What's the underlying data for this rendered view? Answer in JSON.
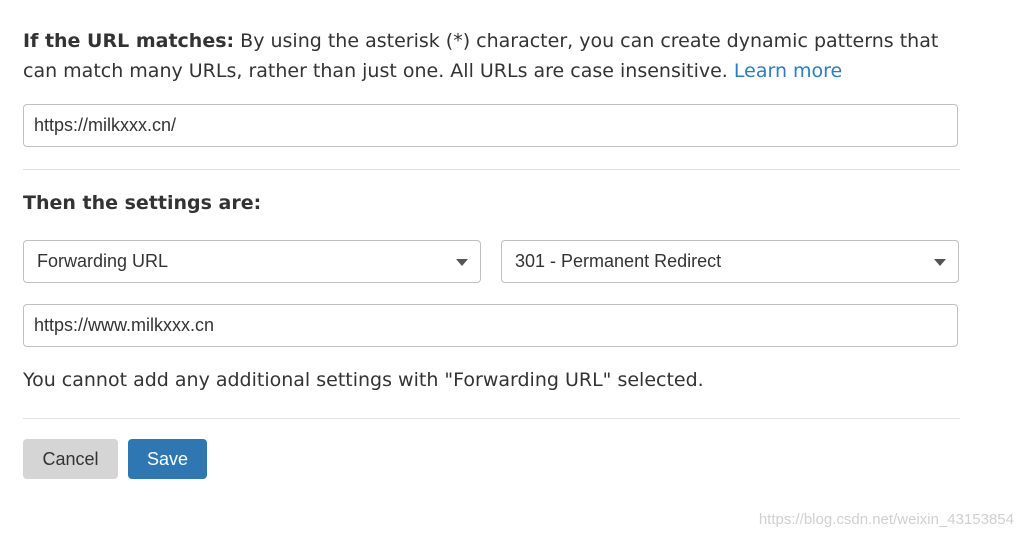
{
  "intro": {
    "label": "If the URL matches:",
    "text": "By using the asterisk (*) character, you can create dynamic patterns that can match many URLs, rather than just one. All URLs are case insensitive.",
    "link": "Learn more"
  },
  "url_input": {
    "value": "https://milkxxx.cn/"
  },
  "settings": {
    "title": "Then the settings are:",
    "setting_select": "Forwarding URL",
    "status_select": "301 - Permanent Redirect",
    "destination_value": "https://www.milkxxx.cn",
    "note": "You cannot add any additional settings with \"Forwarding URL\" selected."
  },
  "actions": {
    "cancel_label": "Cancel",
    "save_label": "Save"
  },
  "watermark": "https://blog.csdn.net/weixin_43153854",
  "colors": {
    "link": "#2f7bbf",
    "save_button": "#2e77b2",
    "cancel_button": "#d5d5d5"
  },
  "icons": {
    "select_caret": "caret-down-icon"
  }
}
